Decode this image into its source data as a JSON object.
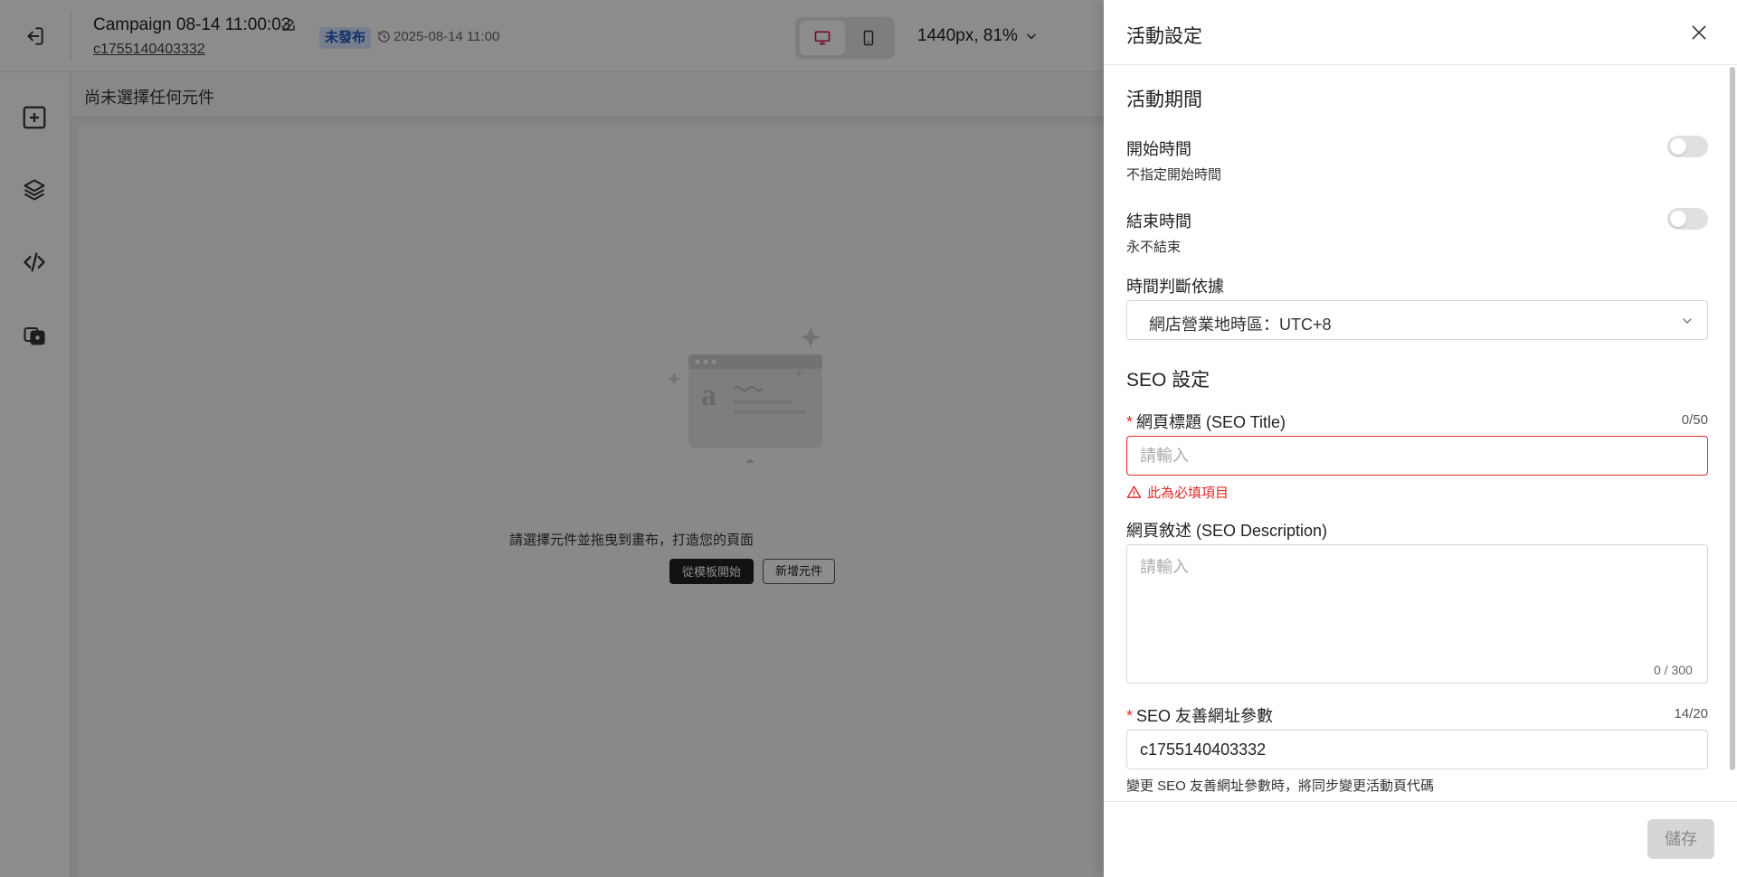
{
  "header": {
    "campaign_title": "Campaign 08-14 11:00:03",
    "campaign_code": "c1755140403332",
    "status_badge": "未發布",
    "schedule_time": "2025-08-14 11:00",
    "zoom_label": "1440px, 81%"
  },
  "sidebar": {
    "icons": [
      "exit-icon",
      "add-block-icon",
      "layers-icon",
      "code-icon",
      "assets-icon"
    ]
  },
  "canvas": {
    "selection_text": "尚未選擇任何元件",
    "empty_message": "請選擇元件並拖曳到畫布，打造您的頁面",
    "from_template_label": "從模板開始",
    "add_component_label": "新增元件"
  },
  "drawer": {
    "title": "活動設定",
    "period": {
      "section_title": "活動期間",
      "start_label": "開始時間",
      "start_desc": "不指定開始時間",
      "start_enabled": false,
      "end_label": "結束時間",
      "end_desc": "永不結束",
      "end_enabled": false,
      "timezone_label": "時間判斷依據",
      "timezone_value": "網店營業地時區：UTC+8"
    },
    "seo": {
      "section_title": "SEO 設定",
      "title_label": "網頁標題 (SEO Title)",
      "title_counter": "0/50",
      "title_placeholder": "請輸入",
      "title_value": "",
      "title_error": "此為必填項目",
      "description_label": "網頁敘述 (SEO Description)",
      "description_placeholder": "請輸入",
      "description_counter": "0 / 300",
      "slug_label": "SEO 友善網址參數",
      "slug_counter": "14/20",
      "slug_value": "c1755140403332",
      "slug_hint": "變更 SEO 友善網址參數時，將同步變更活動頁代碼"
    },
    "save_label": "儲存"
  },
  "colors": {
    "error": "#e02d2d",
    "badge_bg": "#d9e8ff",
    "badge_text": "#1f54c4",
    "overlay": "rgba(0,0,0,0.45)",
    "device_active": "#d4145a"
  }
}
